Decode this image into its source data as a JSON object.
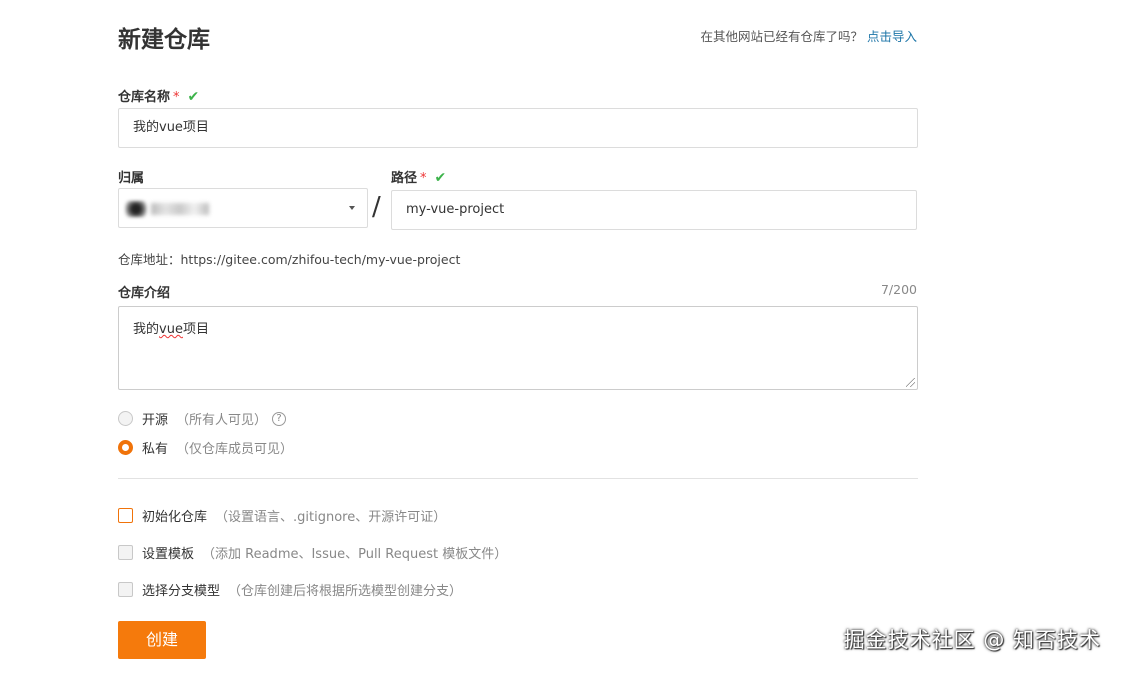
{
  "header": {
    "title": "新建仓库",
    "import_question": "在其他网站已经有仓库了吗？",
    "import_link": "点击导入"
  },
  "repo_name": {
    "label": "仓库名称",
    "required_mark": "*",
    "valid_mark": "✔",
    "value": "我的vue项目"
  },
  "owner": {
    "label": "归属"
  },
  "path": {
    "separator": "/",
    "label": "路径",
    "required_mark": "*",
    "valid_mark": "✔",
    "value": "my-vue-project"
  },
  "address": {
    "text": "仓库地址：https://gitee.com/zhifou-tech/my-vue-project"
  },
  "description": {
    "label": "仓库介绍",
    "counter": "7/200",
    "value_prefix": "我的",
    "value_underlined": "vue",
    "value_suffix": "项目"
  },
  "visibility": {
    "options": [
      {
        "label": "开源",
        "hint": "（所有人可见）",
        "help": "?",
        "selected": false
      },
      {
        "label": "私有",
        "hint": "（仅仓库成员可见）",
        "selected": true
      }
    ]
  },
  "extras": [
    {
      "label": "初始化仓库",
      "hint": "（设置语言、.gitignore、开源许可证）",
      "checked": false
    },
    {
      "label": "设置模板",
      "hint": "（添加 Readme、Issue、Pull Request 模板文件）",
      "checked": false
    },
    {
      "label": "选择分支模型",
      "hint": "（仓库创建后将根据所选模型创建分支）",
      "checked": false
    }
  ],
  "submit": {
    "label": "创建"
  },
  "watermark": "掘金技术社区 @ 知否技术",
  "colors": {
    "accent": "#f57a0c",
    "link": "#1e76a8",
    "valid": "#3cb34a",
    "required": "#ee3333"
  }
}
